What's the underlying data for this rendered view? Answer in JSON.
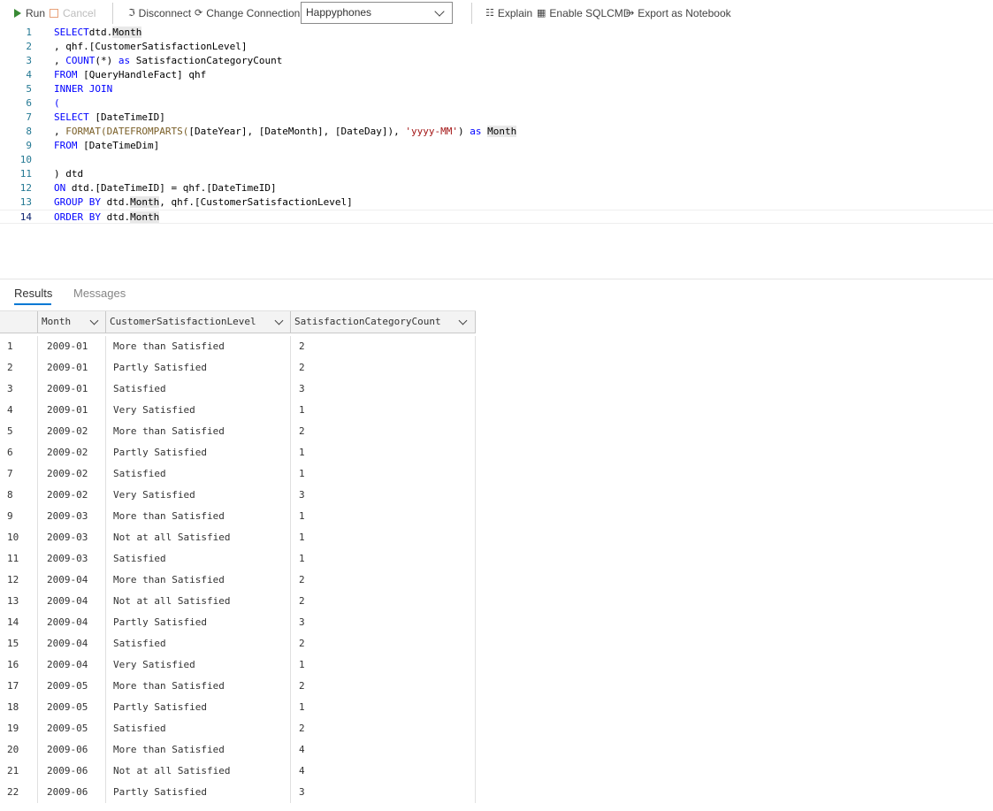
{
  "toolbar": {
    "run_label": "Run",
    "cancel_label": "Cancel",
    "disconnect_label": "Disconnect",
    "change_connection_label": "Change Connection",
    "connection_value": "Happyphones",
    "explain_label": "Explain",
    "sqlcmd_label": "Enable SQLCMD",
    "export_label": "Export as Notebook"
  },
  "editor": {
    "current_line": 14,
    "lines": [
      {
        "n": "1",
        "tokens": [
          [
            "kw",
            "SELECT"
          ],
          [
            "",
            "dtd."
          ],
          [
            "hl",
            "Month"
          ]
        ]
      },
      {
        "n": "2",
        "tokens": [
          [
            "",
            ", qhf.[CustomerSatisfactionLevel]"
          ]
        ]
      },
      {
        "n": "3",
        "tokens": [
          [
            "",
            ", "
          ],
          [
            "kw",
            "COUNT"
          ],
          [
            "",
            "(*) "
          ],
          [
            "kw",
            "as"
          ],
          [
            "",
            " SatisfactionCategoryCount"
          ]
        ]
      },
      {
        "n": "4",
        "tokens": [
          [
            "kw",
            "FROM"
          ],
          [
            "",
            " [QueryHandleFact] qhf"
          ]
        ]
      },
      {
        "n": "5",
        "tokens": [
          [
            "kw",
            "INNER JOIN"
          ]
        ]
      },
      {
        "n": "6",
        "tokens": [
          [
            "kw",
            "("
          ]
        ]
      },
      {
        "n": "7",
        "tokens": [
          [
            "kw",
            "SELECT"
          ],
          [
            "",
            " [DateTimeID]"
          ]
        ]
      },
      {
        "n": "8",
        "tokens": [
          [
            "",
            ", "
          ],
          [
            "fn",
            "FORMAT(DATEFROMPARTS("
          ],
          [
            "",
            "[DateYear], [DateMonth], [DateDay]), "
          ],
          [
            "str",
            "'yyyy-MM'"
          ],
          [
            "",
            ") "
          ],
          [
            "kw",
            "as"
          ],
          [
            "",
            " "
          ],
          [
            "hl",
            "Month"
          ]
        ]
      },
      {
        "n": "9",
        "tokens": [
          [
            "kw",
            "FROM"
          ],
          [
            "",
            " [DateTimeDim]"
          ]
        ]
      },
      {
        "n": "10",
        "tokens": []
      },
      {
        "n": "11",
        "tokens": [
          [
            "",
            ") dtd"
          ]
        ]
      },
      {
        "n": "12",
        "tokens": [
          [
            "kw",
            "ON"
          ],
          [
            "",
            " dtd.[DateTimeID] = qhf.[DateTimeID]"
          ]
        ]
      },
      {
        "n": "13",
        "tokens": [
          [
            "kw",
            "GROUP BY"
          ],
          [
            "",
            " dtd."
          ],
          [
            "hl",
            "Month"
          ],
          [
            "",
            ", qhf.[CustomerSatisfactionLevel]"
          ]
        ]
      },
      {
        "n": "14",
        "tokens": [
          [
            "kw",
            "ORDER BY"
          ],
          [
            "",
            " dtd."
          ],
          [
            "hl",
            "Month"
          ]
        ]
      }
    ]
  },
  "results": {
    "tabs": [
      {
        "label": "Results",
        "active": true
      },
      {
        "label": "Messages",
        "active": false
      }
    ],
    "columns": [
      "Month",
      "CustomerSatisfactionLevel",
      "SatisfactionCategoryCount"
    ],
    "rows": [
      [
        "1",
        "2009-01",
        "More than Satisfied",
        "2"
      ],
      [
        "2",
        "2009-01",
        "Partly Satisfied",
        "2"
      ],
      [
        "3",
        "2009-01",
        "Satisfied",
        "3"
      ],
      [
        "4",
        "2009-01",
        "Very Satisfied",
        "1"
      ],
      [
        "5",
        "2009-02",
        "More than Satisfied",
        "2"
      ],
      [
        "6",
        "2009-02",
        "Partly Satisfied",
        "1"
      ],
      [
        "7",
        "2009-02",
        "Satisfied",
        "1"
      ],
      [
        "8",
        "2009-02",
        "Very Satisfied",
        "3"
      ],
      [
        "9",
        "2009-03",
        "More than Satisfied",
        "1"
      ],
      [
        "10",
        "2009-03",
        "Not at all Satisfied",
        "1"
      ],
      [
        "11",
        "2009-03",
        "Satisfied",
        "1"
      ],
      [
        "12",
        "2009-04",
        "More than Satisfied",
        "2"
      ],
      [
        "13",
        "2009-04",
        "Not at all Satisfied",
        "2"
      ],
      [
        "14",
        "2009-04",
        "Partly Satisfied",
        "3"
      ],
      [
        "15",
        "2009-04",
        "Satisfied",
        "2"
      ],
      [
        "16",
        "2009-04",
        "Very Satisfied",
        "1"
      ],
      [
        "17",
        "2009-05",
        "More than Satisfied",
        "2"
      ],
      [
        "18",
        "2009-05",
        "Partly Satisfied",
        "1"
      ],
      [
        "19",
        "2009-05",
        "Satisfied",
        "2"
      ],
      [
        "20",
        "2009-06",
        "More than Satisfied",
        "4"
      ],
      [
        "21",
        "2009-06",
        "Not at all Satisfied",
        "4"
      ],
      [
        "22",
        "2009-06",
        "Partly Satisfied",
        "3"
      ]
    ]
  },
  "colors": {
    "keyword": "#0000ff",
    "function": "#795e26",
    "string": "#a31515",
    "line_number": "#237893",
    "accent": "#0078d4",
    "run_icon": "#388a34"
  }
}
